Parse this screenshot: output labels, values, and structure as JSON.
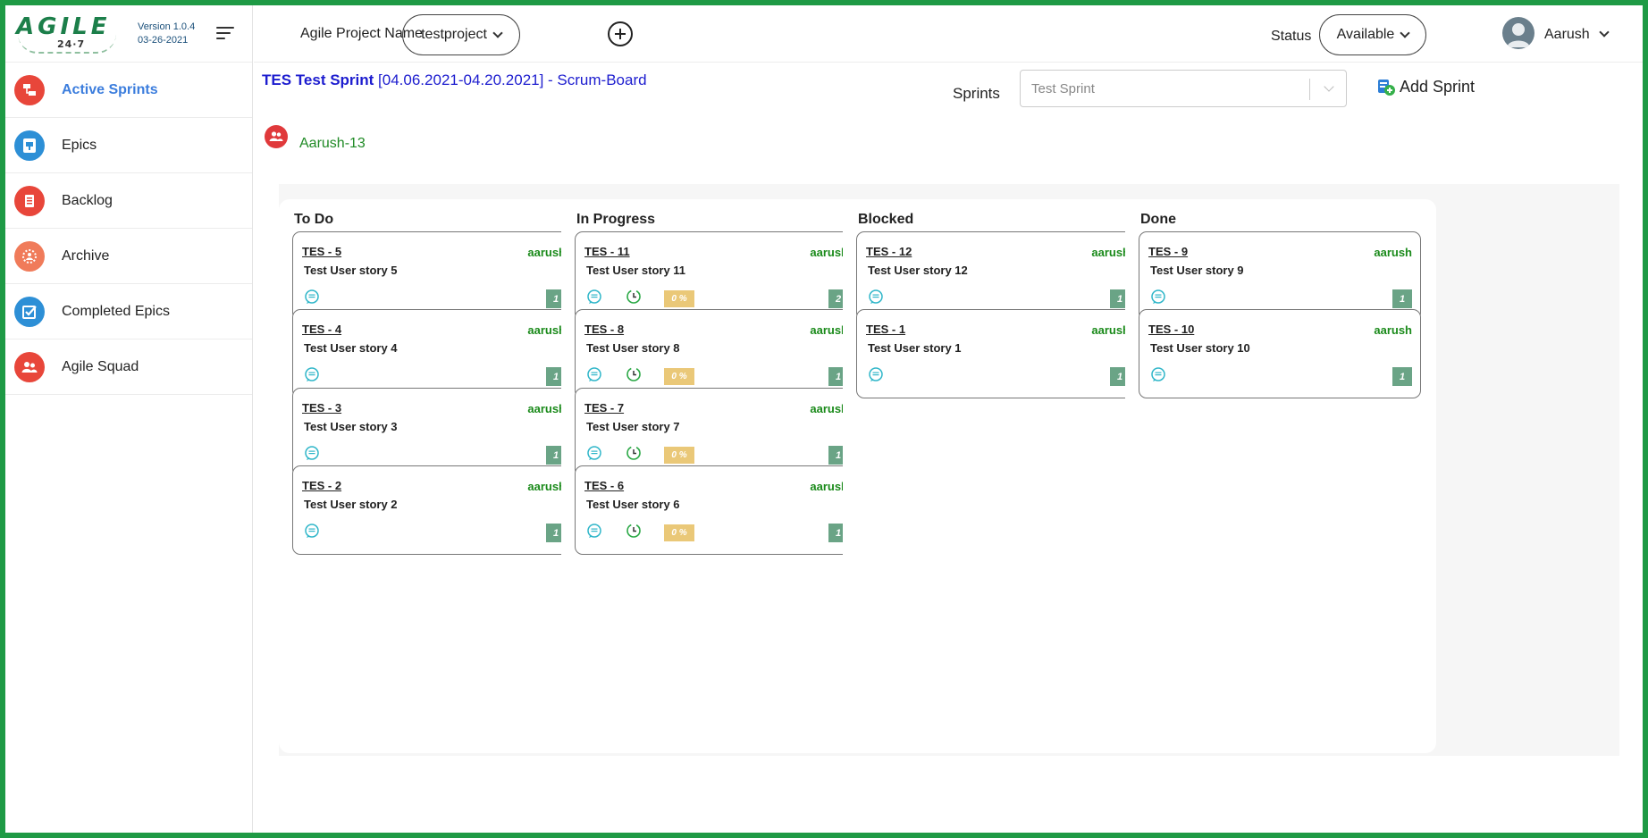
{
  "app": {
    "logo_text": "AGILE",
    "logo_sub": "24·7",
    "version": "Version 1.0.4",
    "date": "03-26-2021"
  },
  "sidebar": {
    "items": [
      {
        "label": "Active Sprints",
        "icon": "active-sprints-icon",
        "color": "#e8463a",
        "active": true
      },
      {
        "label": "Epics",
        "icon": "epics-icon",
        "color": "#2d8fd6",
        "active": false
      },
      {
        "label": "Backlog",
        "icon": "backlog-icon",
        "color": "#e8463a",
        "active": false
      },
      {
        "label": "Archive",
        "icon": "archive-icon",
        "color": "#f07b5a",
        "active": false
      },
      {
        "label": "Completed Epics",
        "icon": "completed-epics-icon",
        "color": "#2d8fd6",
        "active": false
      },
      {
        "label": "Agile Squad",
        "icon": "agile-squad-icon",
        "color": "#e8463a",
        "active": false
      }
    ]
  },
  "header": {
    "project_label": "Agile Project Name",
    "project_value": "testproject",
    "status_label": "Status",
    "status_value": "Available",
    "user_name": "Aarush"
  },
  "sprint": {
    "name": "TES Test Sprint",
    "range": "[04.06.2021-04.20.2021] - Scrum-Board",
    "sprints_label": "Sprints",
    "sprints_placeholder": "Test Sprint",
    "add_sprint_label": "Add Sprint",
    "member": "Aarush-13"
  },
  "board": {
    "columns": [
      {
        "title": "To Do",
        "cards": [
          {
            "id": "TES - 5",
            "owner": "aarush",
            "title": "Test User story 5",
            "points": "1"
          },
          {
            "id": "TES - 4",
            "owner": "aarush",
            "title": "Test User story 4",
            "points": "1"
          },
          {
            "id": "TES - 3",
            "owner": "aarush",
            "title": "Test User story 3",
            "points": "1"
          },
          {
            "id": "TES - 2",
            "owner": "aarush",
            "title": "Test User story 2",
            "points": "1"
          }
        ]
      },
      {
        "title": "In Progress",
        "cards": [
          {
            "id": "TES - 11",
            "owner": "aarush",
            "title": "Test User story 11",
            "progress": "0 %",
            "points": "2"
          },
          {
            "id": "TES - 8",
            "owner": "aarush",
            "title": "Test User story 8",
            "progress": "0 %",
            "points": "1"
          },
          {
            "id": "TES - 7",
            "owner": "aarush",
            "title": "Test User story 7",
            "progress": "0 %",
            "points": "1"
          },
          {
            "id": "TES - 6",
            "owner": "aarush",
            "title": "Test User story 6",
            "progress": "0 %",
            "points": "1"
          }
        ]
      },
      {
        "title": "Blocked",
        "cards": [
          {
            "id": "TES - 12",
            "owner": "aarush",
            "title": "Test User story 12",
            "points": "1"
          },
          {
            "id": "TES - 1",
            "owner": "aarush",
            "title": "Test User story 1",
            "points": "1"
          }
        ]
      },
      {
        "title": "Done",
        "cards": [
          {
            "id": "TES - 9",
            "owner": "aarush",
            "title": "Test User story 9",
            "points": "1"
          },
          {
            "id": "TES - 10",
            "owner": "aarush",
            "title": "Test User story 10",
            "points": "1"
          }
        ]
      }
    ]
  }
}
